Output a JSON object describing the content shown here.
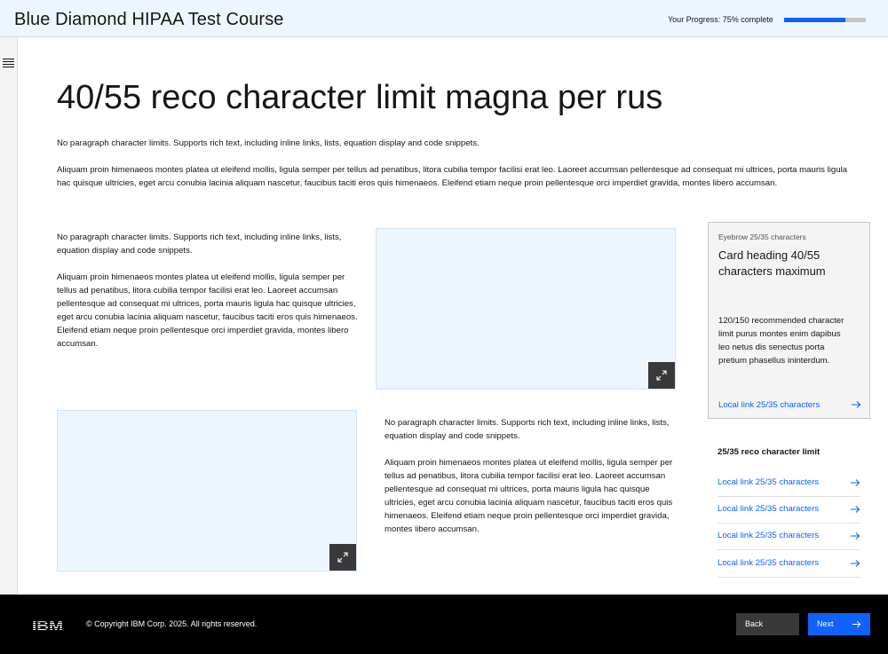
{
  "header": {
    "course_title": "Blue Diamond HIPAA Test Course",
    "progress_label": "Your Progress: 75% complete",
    "progress_fraction": 0.75,
    "accent_color": "#0f62fe"
  },
  "sidebar": {
    "menu_icon": "menu-icon"
  },
  "main": {
    "title": "40/55 reco character limit magna per rus",
    "intro": [
      "No paragraph character limits. Supports rich text, including inline links, lists, equation display and code snippets.",
      "Aliquam proin himenaeos montes platea ut eleifend mollis, ligula semper per tellus ad penatibus, litora cubilia tempor facilisi erat leo. Laoreet accumsan pellentesque ad consequat mi ultrices, porta mauris ligula hac quisque ultricies, eget arcu conubia lacinia aliquam nascetur, faucibus taciti eros quis himenaeos. Eleifend etiam neque proin pellentesque orci imperdiet gravida, montes libero accumsan."
    ],
    "left_column": [
      "No paragraph character limits. Supports rich text, including inline links, lists, equation display and code snippets.",
      "Aliquam proin himenaeos montes platea ut eleifend mollis, ligula semper per tellus ad penatibus, litora cubilia tempor facilisi erat leo. Laoreet accumsan pellentesque ad consequat mi ultrices, porta mauris ligula hac quisque ultricies, eget arcu conubia lacinia aliquam nascetur, faucibus taciti eros quis himenaeos. Eleifend etiam neque proin pellentesque orci imperdiet gravida, montes libero accumsan."
    ],
    "right_column": [
      "No paragraph character limits. Supports rich text, including inline links, lists, equation display and code snippets.",
      "Aliquam proin himenaeos montes platea ut eleifend mollis, ligula semper per tellus ad penatibus, litora cubilia tempor facilisi erat leo. Laoreet accumsan pellentesque ad consequat mi ultrices, porta mauris ligula hac quisque ultricies, eget arcu conubia lacinia aliquam nascetur, faucibus taciti eros quis himenaeos. Eleifend etiam neque proin pellentesque orci imperdiet gravida, montes libero accumsan."
    ],
    "media_expand_icon": "maximize-icon"
  },
  "card": {
    "eyebrow": "Eyebrow 25/35 characters",
    "heading": "Card heading 40/55 characters maximum",
    "body": "120/150 recommended character limit purus montes enim dapibus leo netus dis senectus porta pretium phasellus ininterdum.",
    "link": "Local link 25/35 characters",
    "link_icon": "arrow-right-icon"
  },
  "links": {
    "title": "25/35 reco character limit",
    "items": [
      {
        "label": "Local link 25/35 characters"
      },
      {
        "label": "Local link 25/35 characters"
      },
      {
        "label": "Local link 25/35 characters"
      },
      {
        "label": "Local link 25/35 characters"
      }
    ]
  },
  "footer": {
    "logo": "IBM",
    "copyright": "© Copyright IBM Corp. 2025. All rights reserved.",
    "back_label": "Back",
    "next_label": "Next"
  }
}
